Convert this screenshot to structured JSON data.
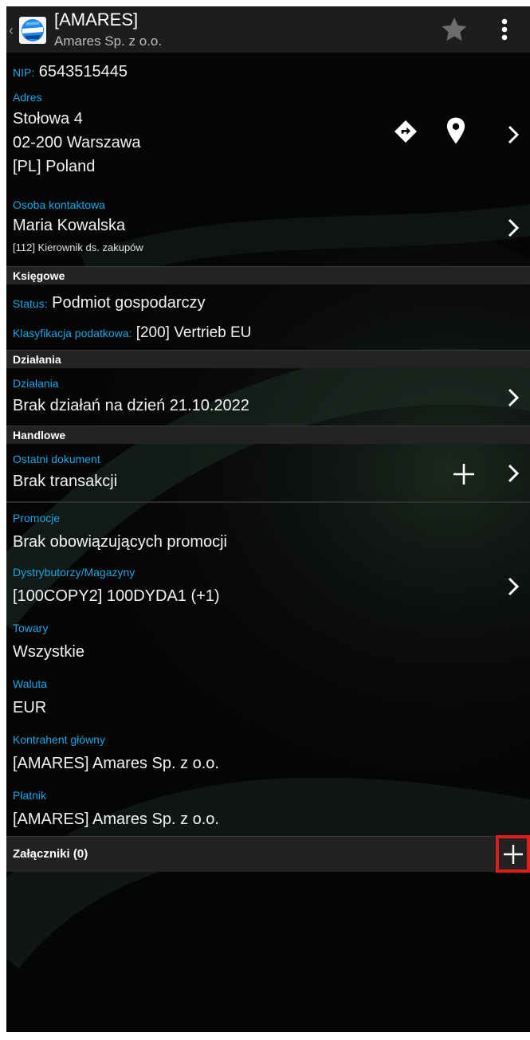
{
  "header": {
    "title": "[AMARES]",
    "subtitle": "Amares Sp. z o.o."
  },
  "details": {
    "nip_label": "NIP:",
    "nip_value": "6543515445",
    "address_label": "Adres",
    "address_line1": "Stołowa 4",
    "address_line2": "02-200 Warszawa",
    "address_line3": "[PL] Poland",
    "contact_label": "Osoba kontaktowa",
    "contact_name": "Maria Kowalska",
    "contact_role": "[112] Kierownik ds. zakupów"
  },
  "accounting": {
    "section_title": "Księgowe",
    "status_label": "Status:",
    "status_value": "Podmiot gospodarczy",
    "tax_label": "Klasyfikacja podatkowa:",
    "tax_value": "[200] Vertrieb EU"
  },
  "actions": {
    "section_title": "Działania",
    "label": "Działania",
    "value": "Brak działań na dzień 21.10.2022"
  },
  "commercial": {
    "section_title": "Handlowe",
    "last_doc_label": "Ostatni dokument",
    "last_doc_value": "Brak transakcji",
    "promo_label": "Promocje",
    "promo_value": "Brak obowiązujących promocji",
    "distrib_label": "Dystrybutorzy/Magazyny",
    "distrib_value": "[100COPY2] 100DYDA1 (+1)",
    "goods_label": "Towary",
    "goods_value": "Wszystkie",
    "currency_label": "Waluta",
    "currency_value": "EUR",
    "main_contractor_label": "Kontrahent główny",
    "main_contractor_value": "[AMARES] Amares Sp. z o.o.",
    "payer_label": "Płatnik",
    "payer_value": "[AMARES] Amares Sp. z o.o."
  },
  "attachments": {
    "label": "Załączniki (0)"
  },
  "colors": {
    "accent": "#19a6e6",
    "highlight": "#e11c1c"
  }
}
